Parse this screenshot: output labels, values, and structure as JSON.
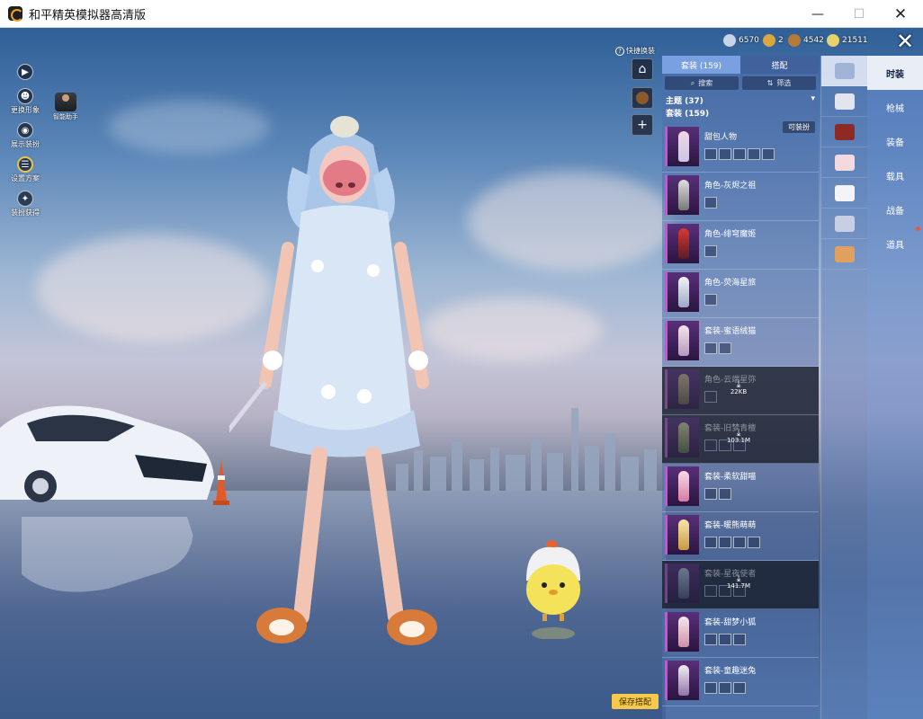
{
  "window": {
    "title": "和平精英模拟器高清版",
    "minimize": "—",
    "maximize": "☐",
    "close": "✕"
  },
  "left_menu": {
    "items": [
      {
        "icon": "play-icon",
        "label": ""
      },
      {
        "icon": "change-look-icon",
        "label": "更换形象"
      },
      {
        "icon": "eye-icon",
        "label": "展示装扮"
      },
      {
        "icon": "plan-icon",
        "label": "设置方案"
      },
      {
        "icon": "gift-icon",
        "label": "装扮获得"
      }
    ],
    "assistant_label": "智能助手"
  },
  "quick_swap": {
    "label": "快捷换装",
    "help": "?"
  },
  "side_buttons": [
    "home-icon",
    "medal-icon",
    "plus-icon"
  ],
  "currency": [
    {
      "icon": "coupon-icon",
      "value": "6570",
      "color": "#c9d4e8"
    },
    {
      "icon": "gold-token-icon",
      "value": "2",
      "color": "#d9a640"
    },
    {
      "icon": "bronze-token-icon",
      "value": "4542",
      "color": "#b7793a"
    },
    {
      "icon": "diamond-token-icon",
      "value": "21511",
      "color": "#e8d36a"
    }
  ],
  "panel": {
    "tabs": [
      {
        "label": "套装 (159)",
        "active": true
      },
      {
        "label": "搭配",
        "active": false
      }
    ],
    "search_label": "搜索",
    "filter_label": "筛选",
    "theme_label": "主题 (37)",
    "suits_label": "套装 (159)",
    "equip_badge": "可装扮"
  },
  "outfits": [
    {
      "name": "甜包人物",
      "parts": 5,
      "dim": false,
      "dl": ""
    },
    {
      "name": "角色-灰烬之祖",
      "parts": 1,
      "dim": false,
      "dl": ""
    },
    {
      "name": "角色-绯穹魔姬",
      "parts": 1,
      "dim": false,
      "dl": ""
    },
    {
      "name": "角色-荧海星旅",
      "parts": 1,
      "dim": false,
      "dl": ""
    },
    {
      "name": "套装-蜜语绒猫",
      "parts": 2,
      "dim": false,
      "dl": ""
    },
    {
      "name": "角色-云端星弥",
      "parts": 1,
      "dim": true,
      "dl": "22KB"
    },
    {
      "name": "套装-旧梦青檀",
      "parts": 3,
      "dim": true,
      "dl": "103.1M"
    },
    {
      "name": "套装-柔软甜喵",
      "parts": 2,
      "dim": false,
      "dl": ""
    },
    {
      "name": "套装-暖熊萌萌",
      "parts": 4,
      "dim": false,
      "dl": ""
    },
    {
      "name": "套装-星夜使者",
      "parts": 3,
      "dim": true,
      "dl": "141.7M"
    },
    {
      "name": "套装-甜梦小狐",
      "parts": 3,
      "dim": false,
      "dl": ""
    },
    {
      "name": "套装-童趣迷兔",
      "parts": 3,
      "dim": false,
      "dl": ""
    }
  ],
  "icon_column": [
    {
      "name": "outfit-icon",
      "color": "#ffffff"
    },
    {
      "name": "hat-icon",
      "color": "#e4e4ee"
    },
    {
      "name": "mask-icon",
      "color": "#8e2a24"
    },
    {
      "name": "face-icon",
      "color": "#f4d9df"
    },
    {
      "name": "top-icon",
      "color": "#f3f3f8"
    },
    {
      "name": "pants-icon",
      "color": "#c7cfe4"
    },
    {
      "name": "shoes-icon",
      "color": "#e0a060"
    }
  ],
  "categories": [
    "时装",
    "枪械",
    "装备",
    "载具",
    "战备",
    "道具"
  ],
  "save_button": "保存搭配",
  "close_panel": "✕"
}
